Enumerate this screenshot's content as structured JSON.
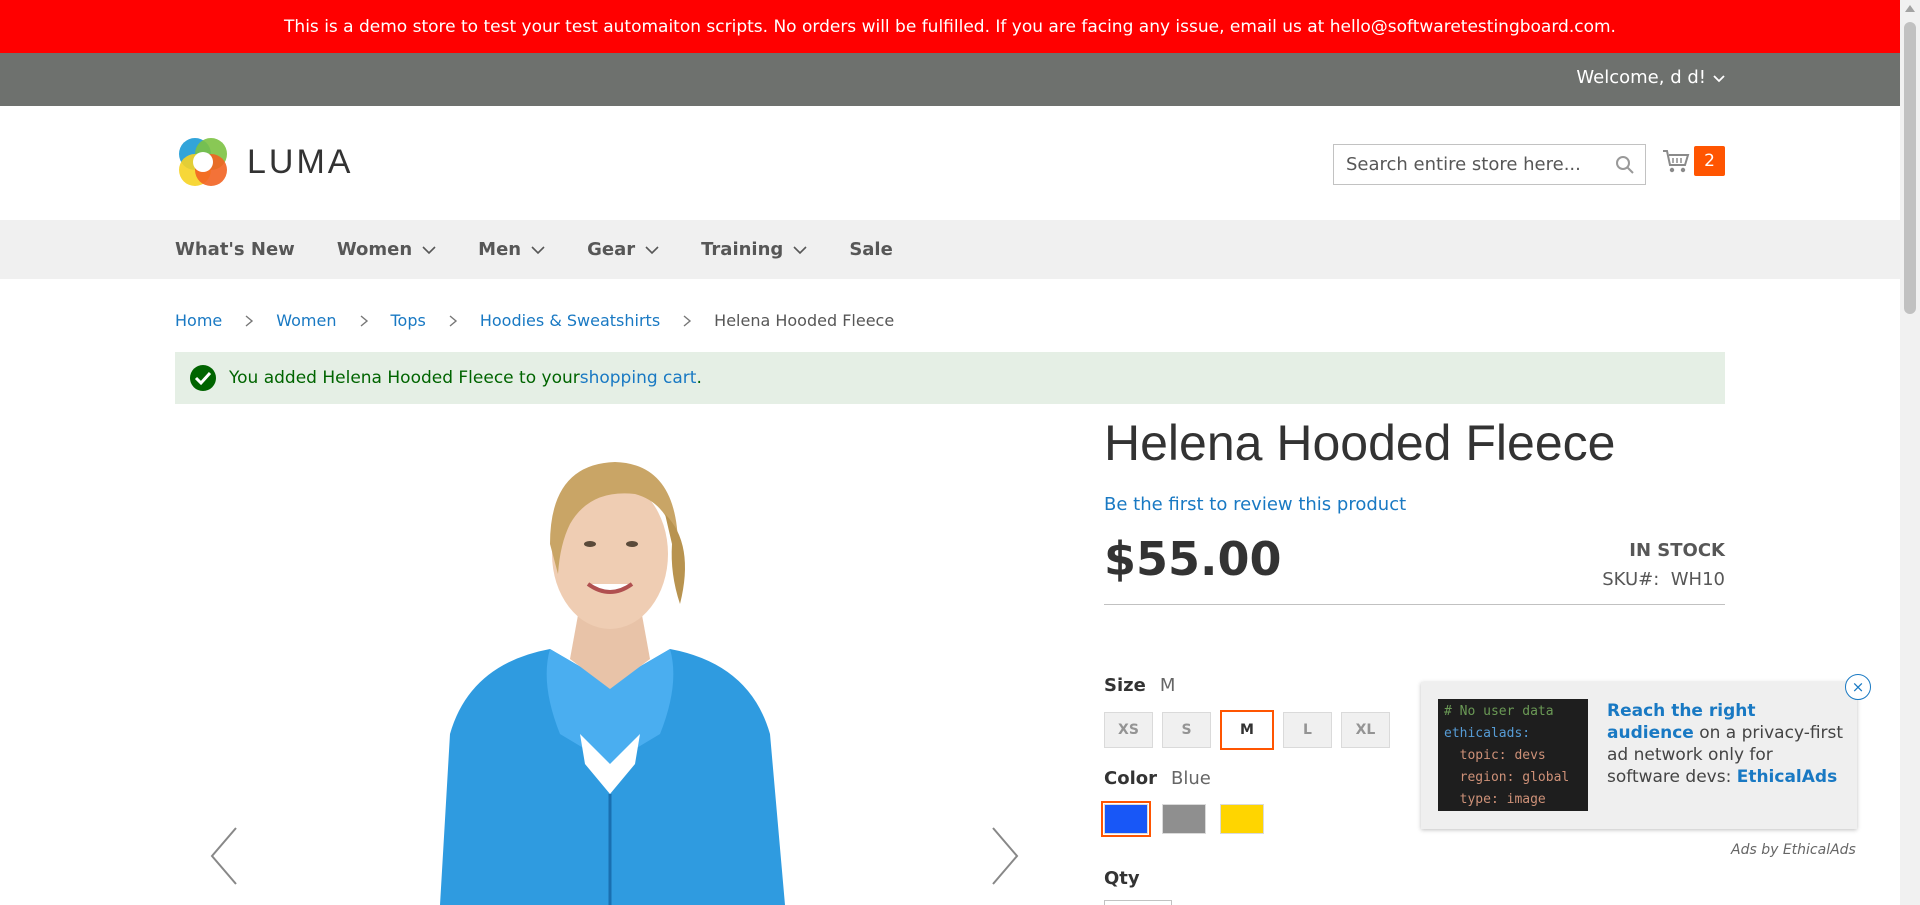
{
  "demo_banner": {
    "text": "This is a demo store to test your test automaiton scripts. No orders will be fulfilled. If you are facing any issue, email us at hello@softwaretestingboard.com."
  },
  "account": {
    "welcome": "Welcome, d d!"
  },
  "logo": {
    "text": "LUMA"
  },
  "search": {
    "placeholder": "Search entire store here..."
  },
  "cart": {
    "count": "2",
    "accent": "#ff5501"
  },
  "nav": {
    "items": [
      {
        "label": "What's New"
      },
      {
        "label": "Women"
      },
      {
        "label": "Men"
      },
      {
        "label": "Gear"
      },
      {
        "label": "Training"
      },
      {
        "label": "Sale"
      }
    ]
  },
  "breadcrumbs": {
    "items": [
      "Home",
      "Women",
      "Tops",
      "Hoodies & Sweatshirts"
    ],
    "current": "Helena Hooded Fleece"
  },
  "message": {
    "prefix": "You added Helena Hooded Fleece to your ",
    "link": "shopping cart",
    "suffix": "."
  },
  "product": {
    "title": "Helena Hooded Fleece",
    "review_link": "Be the first to review this product",
    "price": "$55.00",
    "stock": "IN STOCK",
    "sku_label": "SKU#:",
    "sku": "WH10",
    "size": {
      "label": "Size",
      "selected": "M",
      "options": [
        "XS",
        "S",
        "M",
        "L",
        "XL"
      ]
    },
    "color": {
      "label": "Color",
      "selected": "Blue",
      "options": [
        {
          "name": "Blue",
          "hex": "#1857f7"
        },
        {
          "name": "Gray",
          "hex": "#8f8f8f"
        },
        {
          "name": "Yellow",
          "hex": "#ffd500"
        }
      ]
    },
    "qty_label": "Qty"
  },
  "ad": {
    "code_lines": [
      "# No user data",
      "ethicalads:",
      "  topic: devs",
      "  region: global",
      "  type: image"
    ],
    "headline": "Reach the right audience",
    "body": " on a privacy-first ad network only for software devs: ",
    "brand": "EthicalAds",
    "close": "×",
    "by": "Ads by EthicalAds"
  }
}
